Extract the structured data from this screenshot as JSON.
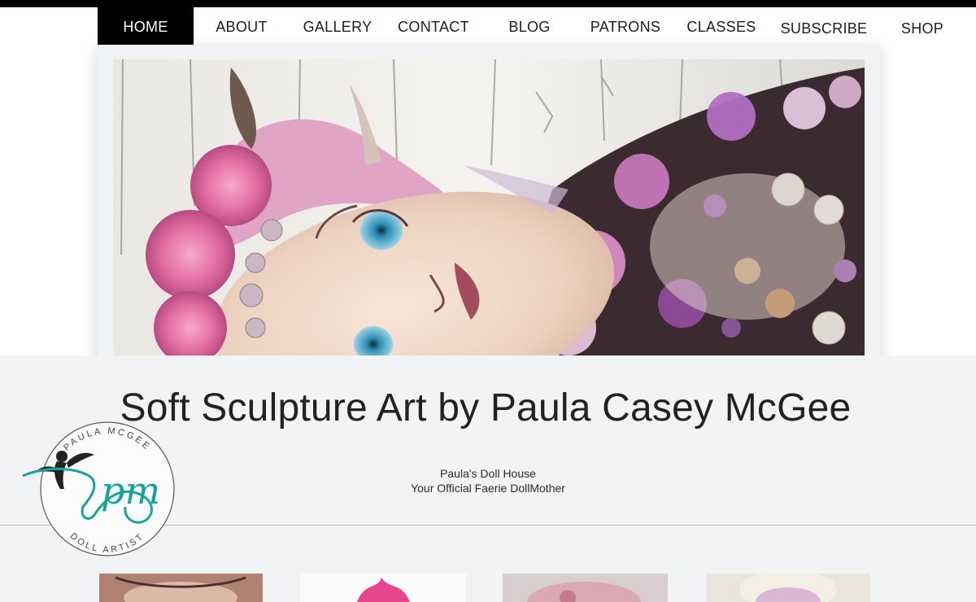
{
  "nav": {
    "items": [
      {
        "label": "HOME",
        "active": true
      },
      {
        "label": "ABOUT"
      },
      {
        "label": "GALLERY"
      },
      {
        "label": "CONTACT"
      },
      {
        "label": "BLOG"
      },
      {
        "label": "PATRONS"
      },
      {
        "label": "CLASSES"
      },
      {
        "label": "SUBSCRIBE"
      },
      {
        "label": "SHOP"
      }
    ]
  },
  "hero": {
    "image": "faerie-doll-face-photo"
  },
  "header": {
    "title": "Soft Sculpture Art by Paula Casey McGee",
    "tagline_line1": "Paula's Doll House",
    "tagline_line2": "Your Official Faerie DollMother"
  },
  "logo": {
    "top_text": "PAULA MCGEE",
    "bottom_text": "DOLL ARTIST",
    "monogram": "pm",
    "accent": "#1aa39a"
  },
  "gallery": {
    "thumbnails": [
      "doll-thumb-1",
      "doll-thumb-2",
      "doll-thumb-3",
      "doll-thumb-4"
    ]
  },
  "colors": {
    "nav_active_bg": "#000000",
    "band_bg": "#f2f3f5"
  }
}
